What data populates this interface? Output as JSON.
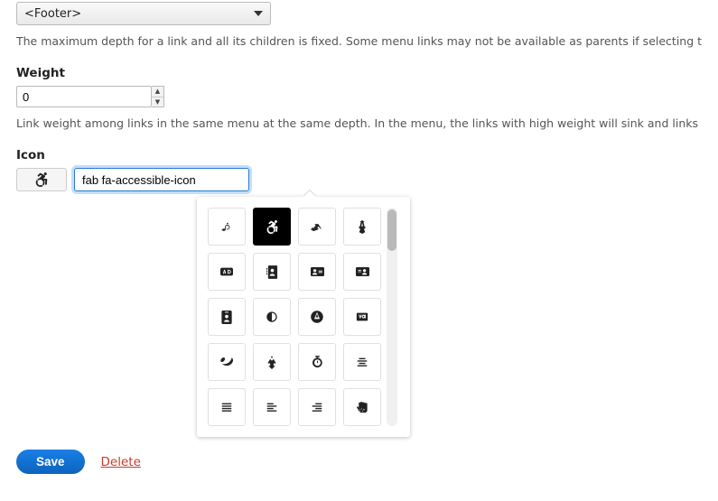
{
  "parent_select": {
    "value": "<Footer>"
  },
  "desc_parent": "The maximum depth for a link and all its children is fixed. Some menu links may not be available as parents if selecting them would exceed this limit.",
  "weight": {
    "label": "Weight",
    "value": "0"
  },
  "desc_weight": "Link weight among links in the same menu at the same depth. In the menu, the links with high weight will sink and links with a low weight will be positioned nearer the top.",
  "icon": {
    "label": "Icon",
    "value": "fab fa-accessible-icon",
    "preview_name": "accessible-icon"
  },
  "picker": {
    "selected_index": 1,
    "icons": [
      "500px",
      "accessible-icon",
      "accusoft",
      "acquisitions-incorporated",
      "ad",
      "address-book",
      "address-card",
      "id-card",
      "id-badge",
      "adjust",
      "adn",
      "adversal",
      "affiliatetheme",
      "air-freshener",
      "stopwatch",
      "align-center",
      "align-justify",
      "align-left",
      "align-right",
      "allergies"
    ]
  },
  "actions": {
    "save": "Save",
    "delete": "Delete"
  }
}
